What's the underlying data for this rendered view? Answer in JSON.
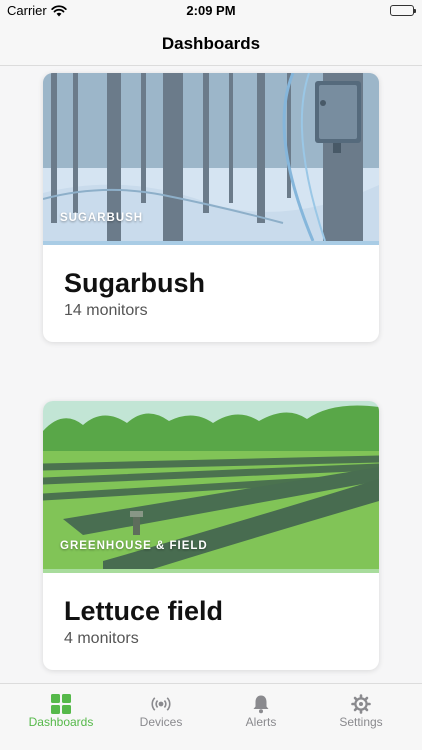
{
  "status_bar": {
    "carrier": "Carrier",
    "time": "2:09 PM"
  },
  "nav": {
    "title": "Dashboards"
  },
  "cards": [
    {
      "category": "SUGARBUSH",
      "name": "Sugarbush",
      "count": "14 monitors",
      "accent": "#a9cce5"
    },
    {
      "category": "GREENHOUSE & FIELD",
      "name": "Lettuce field",
      "count": "4 monitors",
      "accent": "#a8dc9c"
    }
  ],
  "tabs": [
    {
      "label": "Dashboards",
      "icon": "grid-icon",
      "active": true
    },
    {
      "label": "Devices",
      "icon": "broadcast-icon",
      "active": false
    },
    {
      "label": "Alerts",
      "icon": "bell-icon",
      "active": false
    },
    {
      "label": "Settings",
      "icon": "gear-icon",
      "active": false
    }
  ],
  "colors": {
    "active_tab": "#56b94a",
    "inactive_tab": "#8a8a8e"
  }
}
